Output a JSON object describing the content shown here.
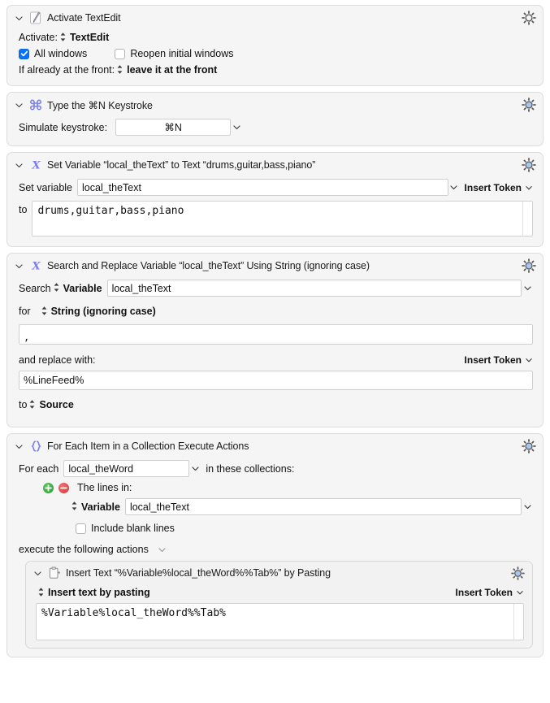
{
  "actions": [
    {
      "id": "activate-textedit",
      "title": "Activate TextEdit",
      "icon": "textedit-icon",
      "activate_label": "Activate:",
      "activate_value": "TextEdit",
      "all_windows_label": "All windows",
      "all_windows_checked": true,
      "reopen_label": "Reopen initial windows",
      "reopen_checked": false,
      "front_label": "If already at the front:",
      "front_value": "leave it at the front"
    },
    {
      "id": "type-keystroke",
      "title": "Type the ⌘N Keystroke",
      "icon": "command-key-icon",
      "simulate_label": "Simulate keystroke:",
      "keystroke_value": "⌘N"
    },
    {
      "id": "set-variable",
      "title": "Set Variable “local_theText” to Text “drums,guitar,bass,piano”",
      "icon": "variable-x-icon",
      "set_variable_label": "Set variable",
      "variable_name": "local_theText",
      "insert_token_label": "Insert Token",
      "to_label": "to",
      "text_value": "drums,guitar,bass,piano"
    },
    {
      "id": "search-replace",
      "title": "Search and Replace Variable “local_theText” Using String (ignoring case)",
      "icon": "variable-x-icon",
      "search_label": "Search",
      "search_target": "Variable",
      "search_variable": "local_theText",
      "for_label": "for",
      "for_value": "String (ignoring case)",
      "search_text": ",",
      "replace_label": "and replace with:",
      "insert_token_label": "Insert Token",
      "replace_text": "%LineFeed%",
      "to_label": "to",
      "to_value": "Source"
    },
    {
      "id": "for-each",
      "title": "For Each Item in a Collection Execute Actions",
      "icon": "braces-icon",
      "for_each_label": "For each",
      "for_each_variable": "local_theWord",
      "in_collections_label": "in these collections:",
      "lines_in_label": "The lines in:",
      "collection_kind": "Variable",
      "collection_variable": "local_theText",
      "include_blank_label": "Include blank lines",
      "include_blank_checked": false,
      "execute_label": "execute the following actions",
      "nested": {
        "id": "insert-text",
        "title": "Insert Text “%Variable%local_theWord%%Tab%” by Pasting",
        "icon": "clipboard-icon",
        "mode_value": "Insert text by pasting",
        "insert_token_label": "Insert Token",
        "text_value": "%Variable%local_theWord%%Tab%"
      }
    }
  ],
  "colors": {
    "accent_blue": "#0a72f5",
    "icon_purple": "#7b7ef0",
    "gear_blue": "#a8c8f0",
    "add_green": "#2a9a31",
    "remove_red": "#d03636",
    "card_bg": "#f5f5f5",
    "card_border": "#dcdcdc"
  }
}
